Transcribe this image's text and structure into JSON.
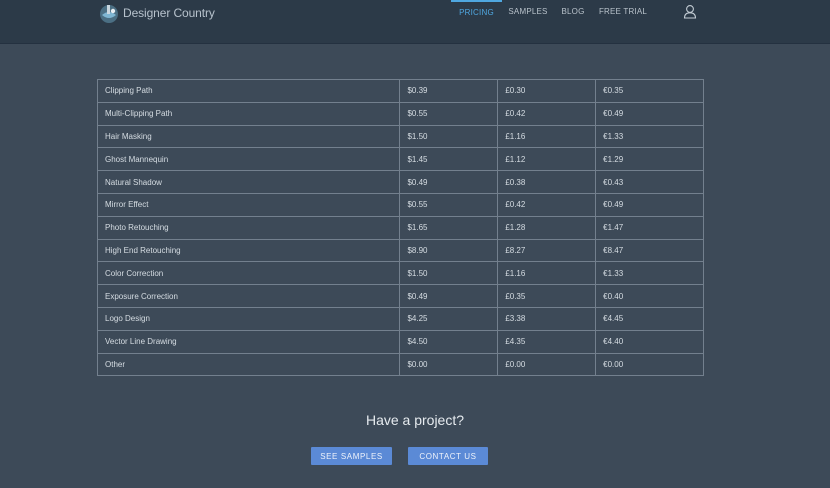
{
  "header": {
    "brand": "Designer Country",
    "nav": [
      {
        "label": "PRICING",
        "active": true
      },
      {
        "label": "SAMPLES",
        "active": false
      },
      {
        "label": "BLOG",
        "active": false
      },
      {
        "label": "FREE TRIAL",
        "active": false
      }
    ],
    "user_icon": "user-outline-icon"
  },
  "pricing_table": {
    "rows": [
      {
        "service": "Clipping Path",
        "usd": "$0.39",
        "gbp": "£0.30",
        "eur": "€0.35"
      },
      {
        "service": "Multi-Clipping Path",
        "usd": "$0.55",
        "gbp": "£0.42",
        "eur": "€0.49"
      },
      {
        "service": "Hair Masking",
        "usd": "$1.50",
        "gbp": "£1.16",
        "eur": "€1.33"
      },
      {
        "service": "Ghost Mannequin",
        "usd": "$1.45",
        "gbp": "£1.12",
        "eur": "€1.29"
      },
      {
        "service": "Natural Shadow",
        "usd": "$0.49",
        "gbp": "£0.38",
        "eur": "€0.43"
      },
      {
        "service": "Mirror Effect",
        "usd": "$0.55",
        "gbp": "£0.42",
        "eur": "€0.49"
      },
      {
        "service": "Photo Retouching",
        "usd": "$1.65",
        "gbp": "£1.28",
        "eur": "€1.47"
      },
      {
        "service": "High End Retouching",
        "usd": "$8.90",
        "gbp": "£8.27",
        "eur": "€8.47"
      },
      {
        "service": "Color Correction",
        "usd": "$1.50",
        "gbp": "£1.16",
        "eur": "€1.33"
      },
      {
        "service": "Exposure Correction",
        "usd": "$0.49",
        "gbp": "£0.35",
        "eur": "€0.40"
      },
      {
        "service": "Logo Design",
        "usd": "$4.25",
        "gbp": "£3.38",
        "eur": "€4.45"
      },
      {
        "service": "Vector Line Drawing",
        "usd": "$4.50",
        "gbp": "£4.35",
        "eur": "€4.40"
      },
      {
        "service": "Other",
        "usd": "$0.00",
        "gbp": "£0.00",
        "eur": "€0.00"
      }
    ]
  },
  "cta": {
    "title": "Have a project?",
    "samples_button": "SEE SAMPLES",
    "contact_button": "CONTACT US"
  },
  "colors": {
    "background": "#3d4a58",
    "header": "#2c3a48",
    "accent": "#4fa7e0",
    "button": "#5b8ad6"
  }
}
